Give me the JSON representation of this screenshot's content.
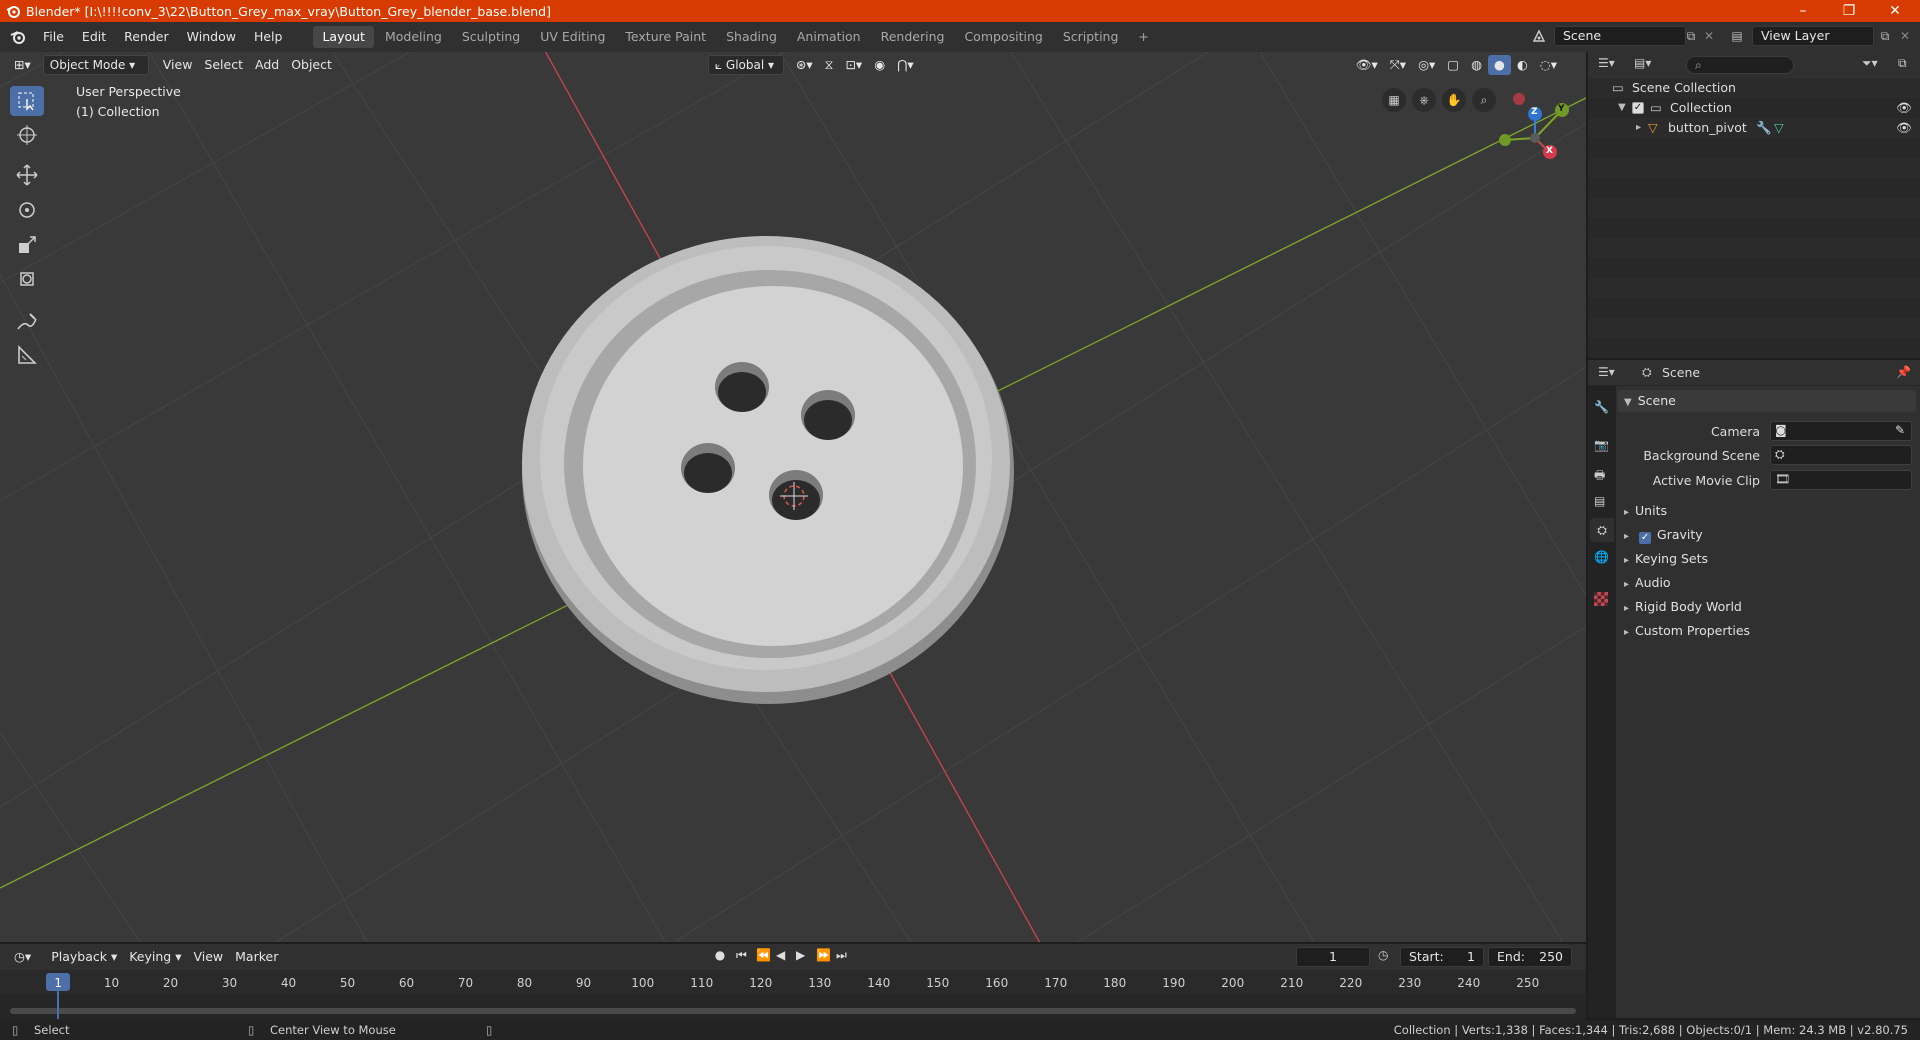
{
  "titlebar": {
    "title": "Blender* [I:\\!!!!conv_3\\22\\Button_Grey_max_vray\\Button_Grey_blender_base.blend]",
    "minimize": "–",
    "maximize": "❐",
    "close": "✕"
  },
  "menu": [
    "File",
    "Edit",
    "Render",
    "Window",
    "Help"
  ],
  "workspaces": [
    "Layout",
    "Modeling",
    "Sculpting",
    "UV Editing",
    "Texture Paint",
    "Shading",
    "Animation",
    "Rendering",
    "Compositing",
    "Scripting"
  ],
  "active_workspace": "Layout",
  "scene_field": "Scene",
  "view_layer_field": "View Layer",
  "viewport": {
    "mode": "Object Mode",
    "menus": [
      "View",
      "Select",
      "Add",
      "Object"
    ],
    "transform_orientation": "Global",
    "overlay_line1": "User Perspective",
    "overlay_line2": "(1) Collection",
    "gizmo": {
      "x": "X",
      "y": "Y",
      "z": "Z"
    }
  },
  "outliner": {
    "root": "Scene Collection",
    "collection": "Collection",
    "object": "button_pivot"
  },
  "properties": {
    "header": "Scene",
    "panel_title": "Scene",
    "camera_label": "Camera",
    "background_scene_label": "Background Scene",
    "active_movie_clip_label": "Active Movie Clip",
    "panels": [
      "Units",
      "Gravity",
      "Keying Sets",
      "Audio",
      "Rigid Body World",
      "Custom Properties"
    ]
  },
  "timeline": {
    "menus": [
      "Playback",
      "Keying",
      "View",
      "Marker"
    ],
    "current_frame": "1",
    "start_label": "Start:",
    "start_value": "1",
    "end_label": "End:",
    "end_value": "250",
    "ticks": [
      "1",
      "10",
      "20",
      "30",
      "40",
      "50",
      "60",
      "70",
      "80",
      "90",
      "100",
      "110",
      "120",
      "130",
      "140",
      "150",
      "160",
      "170",
      "180",
      "190",
      "200",
      "210",
      "220",
      "230",
      "240",
      "250"
    ]
  },
  "statusbar": {
    "left": "Select",
    "middle": "Center View to Mouse",
    "right": "Collection | Verts:1,338 | Faces:1,344 | Tris:2,688 | Objects:0/1 | Mem: 24.3 MB | v2.80.75"
  },
  "colors": {
    "titlebar": "#d83b01",
    "accent_blue": "#4b6fa6",
    "axis_x": "#c8454f",
    "axis_y": "#7fa52a",
    "viewport_bg": "#393939"
  }
}
